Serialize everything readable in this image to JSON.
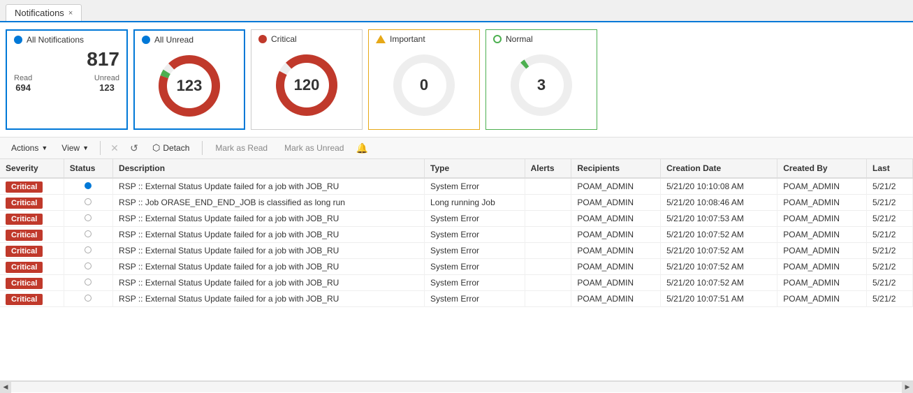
{
  "tab": {
    "label": "Notifications",
    "close_label": "×"
  },
  "cards": {
    "all_notifications": {
      "title": "All Notifications",
      "total": "817",
      "read_label": "Read",
      "read_value": "694",
      "unread_label": "Unread",
      "unread_value": "123"
    },
    "all_unread": {
      "title": "All Unread",
      "value": "123"
    },
    "critical": {
      "title": "Critical",
      "value": "120"
    },
    "important": {
      "title": "Important",
      "value": "0"
    },
    "normal": {
      "title": "Normal",
      "value": "3"
    }
  },
  "toolbar": {
    "actions_label": "Actions",
    "view_label": "View",
    "detach_label": "Detach",
    "mark_as_read_label": "Mark as Read",
    "mark_as_unread_label": "Mark as Unread"
  },
  "table": {
    "columns": [
      "Severity",
      "Status",
      "Description",
      "Type",
      "Alerts",
      "Recipients",
      "Creation Date",
      "Created By",
      "Last"
    ],
    "rows": [
      {
        "severity": "Critical",
        "status": "filled",
        "description": "RSP :: External Status Update failed for a job with JOB_RU",
        "type": "System Error",
        "alerts": "",
        "recipients": "POAM_ADMIN",
        "creation_date": "5/21/20 10:10:08 AM",
        "created_by": "POAM_ADMIN",
        "last": "5/21/2"
      },
      {
        "severity": "Critical",
        "status": "empty",
        "description": "RSP :: Job ORASE_END_END_JOB is classified as long run",
        "type": "Long running Job",
        "alerts": "",
        "recipients": "POAM_ADMIN",
        "creation_date": "5/21/20 10:08:46 AM",
        "created_by": "POAM_ADMIN",
        "last": "5/21/2"
      },
      {
        "severity": "Critical",
        "status": "empty",
        "description": "RSP :: External Status Update failed for a job with JOB_RU",
        "type": "System Error",
        "alerts": "",
        "recipients": "POAM_ADMIN",
        "creation_date": "5/21/20 10:07:53 AM",
        "created_by": "POAM_ADMIN",
        "last": "5/21/2"
      },
      {
        "severity": "Critical",
        "status": "empty",
        "description": "RSP :: External Status Update failed for a job with JOB_RU",
        "type": "System Error",
        "alerts": "",
        "recipients": "POAM_ADMIN",
        "creation_date": "5/21/20 10:07:52 AM",
        "created_by": "POAM_ADMIN",
        "last": "5/21/2"
      },
      {
        "severity": "Critical",
        "status": "empty",
        "description": "RSP :: External Status Update failed for a job with JOB_RU",
        "type": "System Error",
        "alerts": "",
        "recipients": "POAM_ADMIN",
        "creation_date": "5/21/20 10:07:52 AM",
        "created_by": "POAM_ADMIN",
        "last": "5/21/2"
      },
      {
        "severity": "Critical",
        "status": "empty",
        "description": "RSP :: External Status Update failed for a job with JOB_RU",
        "type": "System Error",
        "alerts": "",
        "recipients": "POAM_ADMIN",
        "creation_date": "5/21/20 10:07:52 AM",
        "created_by": "POAM_ADMIN",
        "last": "5/21/2"
      },
      {
        "severity": "Critical",
        "status": "empty",
        "description": "RSP :: External Status Update failed for a job with JOB_RU",
        "type": "System Error",
        "alerts": "",
        "recipients": "POAM_ADMIN",
        "creation_date": "5/21/20 10:07:52 AM",
        "created_by": "POAM_ADMIN",
        "last": "5/21/2"
      },
      {
        "severity": "Critical",
        "status": "empty",
        "description": "RSP :: External Status Update failed for a job with JOB_RU",
        "type": "System Error",
        "alerts": "",
        "recipients": "POAM_ADMIN",
        "creation_date": "5/21/20 10:07:51 AM",
        "created_by": "POAM_ADMIN",
        "last": "5/21/2"
      }
    ]
  }
}
